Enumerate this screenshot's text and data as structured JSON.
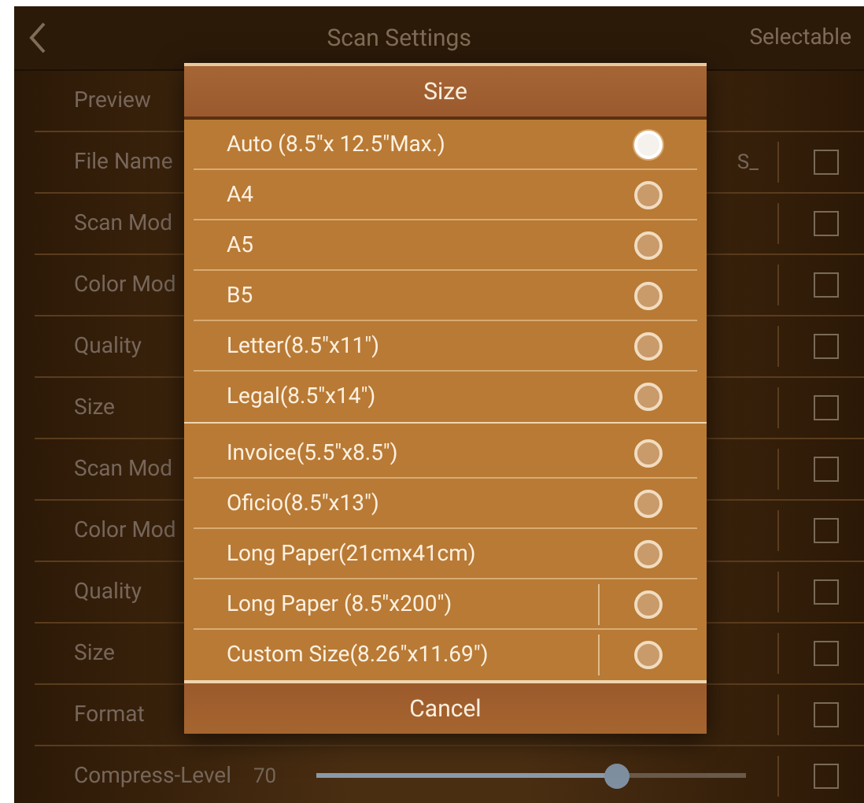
{
  "header": {
    "title": "Scan Settings",
    "action": "Selectable"
  },
  "rows": [
    {
      "kind": "plain",
      "label": "Preview"
    },
    {
      "kind": "check",
      "label": "File Name",
      "value": "S_",
      "checked": false
    },
    {
      "kind": "check",
      "label": "Scan Mod",
      "checked": false
    },
    {
      "kind": "check",
      "label": "Color Mod",
      "checked": false
    },
    {
      "kind": "check",
      "label": "Quality",
      "checked": false
    },
    {
      "kind": "check",
      "label": "Size",
      "checked": false
    },
    {
      "kind": "check",
      "label": "Scan Mod",
      "checked": false
    },
    {
      "kind": "check",
      "label": "Color Mod",
      "checked": false
    },
    {
      "kind": "check",
      "label": "Quality",
      "checked": false
    },
    {
      "kind": "check",
      "label": "Size",
      "checked": false
    },
    {
      "kind": "check",
      "label": "Format",
      "checked": false
    },
    {
      "kind": "slider",
      "label": "Compress-Level",
      "value": "70",
      "level": 0.7,
      "checked": false
    }
  ],
  "dialog": {
    "title": "Size",
    "groups": [
      [
        {
          "kind": "plain",
          "label": "Auto (8.5\"x 12.5\"Max.)",
          "selected": true
        },
        {
          "kind": "plain",
          "label": "A4",
          "selected": false
        },
        {
          "kind": "plain",
          "label": "A5",
          "selected": false
        },
        {
          "kind": "plain",
          "label": "B5",
          "selected": false
        },
        {
          "kind": "plain",
          "label": "Letter(8.5\"x11\")",
          "selected": false
        },
        {
          "kind": "plain",
          "label": "Legal(8.5\"x14\")",
          "selected": false
        }
      ],
      [
        {
          "kind": "plain",
          "label": "Invoice(5.5\"x8.5\")",
          "selected": false
        },
        {
          "kind": "plain",
          "label": "Oficio(8.5\"x13\")",
          "selected": false
        },
        {
          "kind": "plain",
          "label": "Long Paper(21cmx41cm)",
          "selected": false
        },
        {
          "kind": "split",
          "label": "Long Paper (8.5\"x200\")",
          "selected": false
        },
        {
          "kind": "split",
          "label": "Custom Size(8.26\"x11.69\")",
          "selected": false
        }
      ]
    ],
    "cancel": "Cancel"
  }
}
